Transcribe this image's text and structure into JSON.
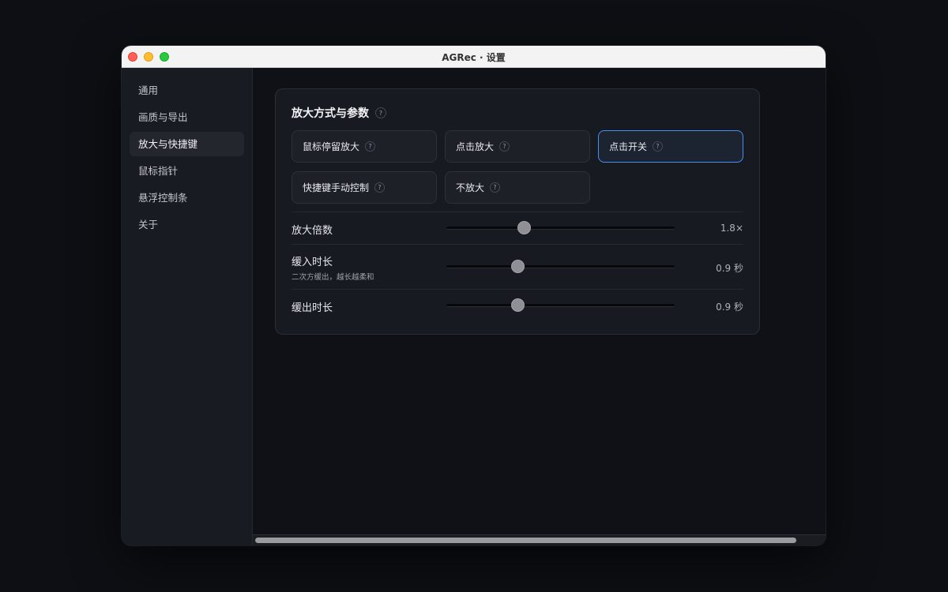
{
  "window": {
    "title": "AGRec · 设置"
  },
  "sidebar": {
    "items": [
      {
        "label": "通用"
      },
      {
        "label": "画质与导出"
      },
      {
        "label": "放大与快捷键",
        "active": true
      },
      {
        "label": "鼠标指针"
      },
      {
        "label": "悬浮控制条"
      },
      {
        "label": "关于"
      }
    ]
  },
  "card": {
    "title": "放大方式与参数",
    "help": "?",
    "modes": [
      {
        "label": "鼠标停留放大",
        "help": "?"
      },
      {
        "label": "点击放大",
        "help": "?"
      },
      {
        "label": "点击开关",
        "help": "?",
        "selected": true
      },
      {
        "label": "快捷键手动控制",
        "help": "?"
      },
      {
        "label": "不放大",
        "help": "?"
      }
    ],
    "settings": {
      "zoom": {
        "label": "放大倍数",
        "value": "1.8×",
        "slider": 0.34
      },
      "ease_in": {
        "label": "缓入时长",
        "sub": "二次方缓出，越长越柔和",
        "value": "0.9 秒",
        "slider": 0.31
      },
      "ease_out": {
        "label": "缓出时长",
        "value": "0.9 秒",
        "slider": 0.31
      }
    }
  },
  "colors": {
    "accent": "#4a8df0",
    "background": "#0d0f14",
    "card": "#171a20"
  }
}
